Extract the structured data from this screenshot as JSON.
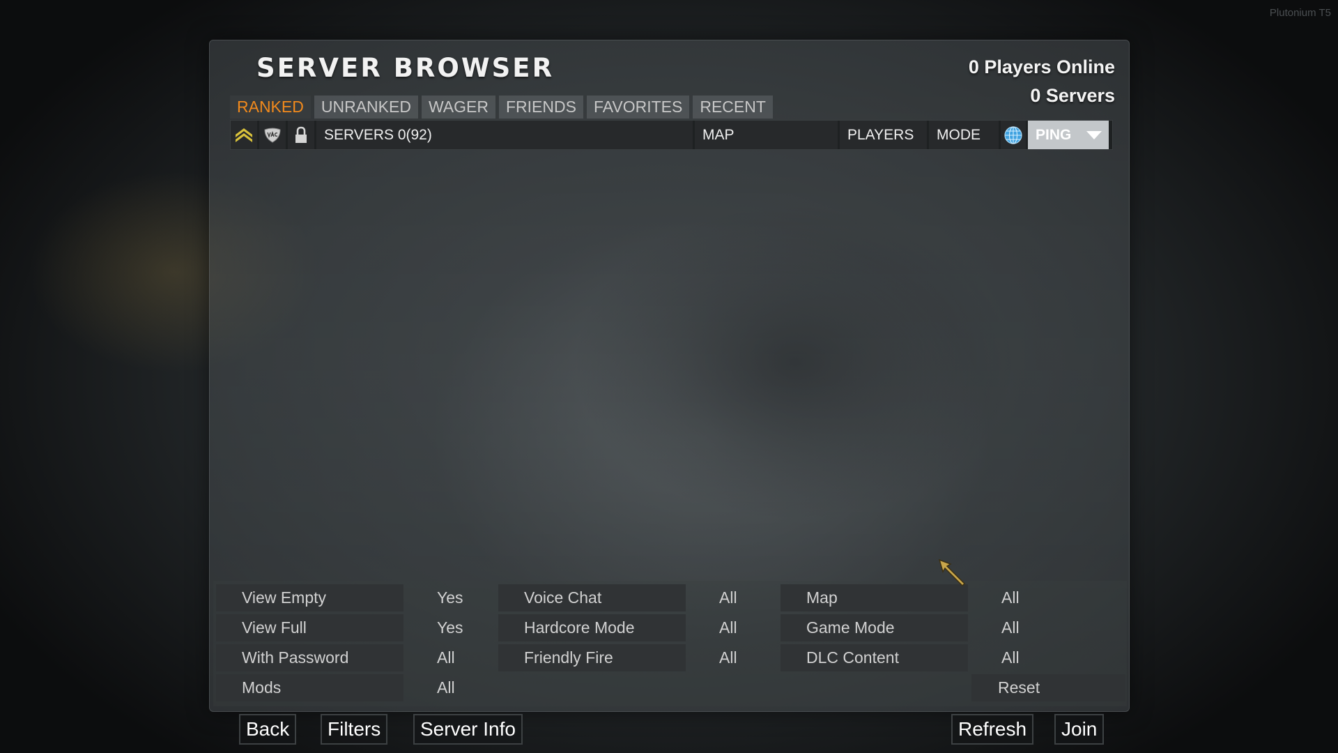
{
  "app": {
    "corner_label": "Plutonium T5"
  },
  "header": {
    "title": "SERVER BROWSER",
    "players_online": "0 Players Online",
    "servers": "0 Servers"
  },
  "tabs": [
    {
      "label": "RANKED",
      "active": true
    },
    {
      "label": "UNRANKED",
      "active": false
    },
    {
      "label": "WAGER",
      "active": false
    },
    {
      "label": "FRIENDS",
      "active": false
    },
    {
      "label": "FAVORITES",
      "active": false
    },
    {
      "label": "RECENT",
      "active": false
    }
  ],
  "columns": {
    "icons": [
      "rank-chevron-icon",
      "vac-icon",
      "lock-icon"
    ],
    "servers": "SERVERS 0(92)",
    "map": "MAP",
    "players": "PLAYERS",
    "mode": "MODE",
    "region_icon": "globe-icon",
    "ping": "PING"
  },
  "filters": {
    "view_empty": {
      "label": "View Empty",
      "value": "Yes"
    },
    "view_full": {
      "label": "View Full",
      "value": "Yes"
    },
    "with_password": {
      "label": "With Password",
      "value": "All"
    },
    "mods": {
      "label": "Mods",
      "value": "All"
    },
    "voice_chat": {
      "label": "Voice Chat",
      "value": "All"
    },
    "hardcore_mode": {
      "label": "Hardcore Mode",
      "value": "All"
    },
    "friendly_fire": {
      "label": "Friendly Fire",
      "value": "All"
    },
    "map": {
      "label": "Map",
      "value": "All"
    },
    "game_mode": {
      "label": "Game Mode",
      "value": "All"
    },
    "dlc_content": {
      "label": "DLC Content",
      "value": "All"
    },
    "reset": "Reset"
  },
  "buttons": {
    "back": "Back",
    "filters": "Filters",
    "server_info": "Server Info",
    "refresh": "Refresh",
    "join": "Join"
  },
  "colors": {
    "active_tab": "#f28a1c",
    "ping_header": "#c3c7ca",
    "rank_icon": "#d9c23b",
    "globe_icon": "#3fa2e0"
  }
}
